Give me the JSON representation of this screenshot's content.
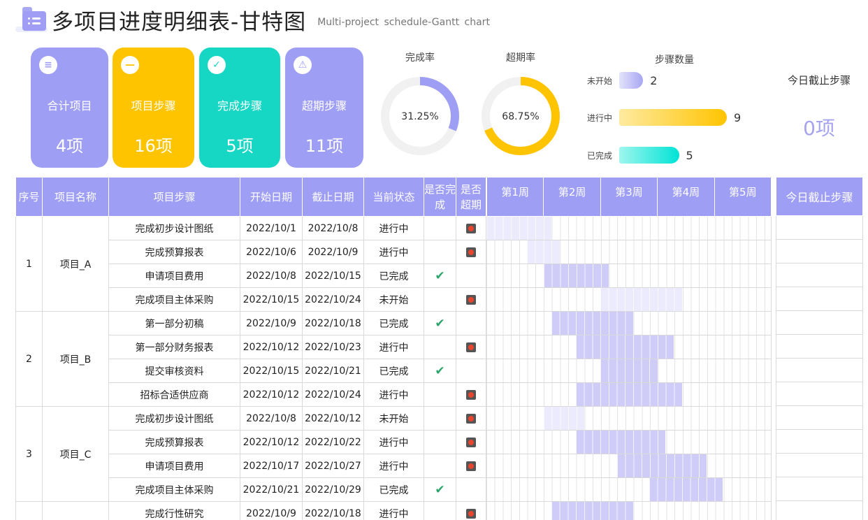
{
  "header": {
    "title": "多项目进度明细表-甘特图",
    "subtitle": "Multi-project  schedule-Gantt  chart"
  },
  "cards": [
    {
      "label": "合计项目",
      "value": "4项",
      "icon": "list-icon",
      "color": "#9f9ef5"
    },
    {
      "label": "项目步骤",
      "value": "16项",
      "icon": "minus-icon",
      "color": "#ffc400"
    },
    {
      "label": "完成步骤",
      "value": "5项",
      "icon": "check-icon",
      "color": "#16d6c4"
    },
    {
      "label": "超期步骤",
      "value": "11项",
      "icon": "warning-icon",
      "color": "#9f9ef5"
    }
  ],
  "donuts": [
    {
      "label": "完成率",
      "text": "31.25%",
      "value": 31.25,
      "color": "#9f9ef5"
    },
    {
      "label": "超期率",
      "text": "68.75%",
      "value": 68.75,
      "color": "#ffc400"
    }
  ],
  "steps": {
    "title": "步骤数量",
    "max": 9,
    "items": [
      {
        "label": "未开始",
        "value": 2
      },
      {
        "label": "进行中",
        "value": 9
      },
      {
        "label": "已完成",
        "value": 5
      }
    ]
  },
  "today": {
    "title": "今日截止步骤",
    "value": "0项"
  },
  "table": {
    "headers": {
      "no": "序号",
      "name": "项目名称",
      "step": "项目步骤",
      "start": "开始日期",
      "end": "截止日期",
      "status": "当前状态",
      "done": "是否完成",
      "overdue": "是否超期"
    },
    "weeks": [
      "第1周",
      "第2周",
      "第3周",
      "第4周",
      "第5周"
    ],
    "side_header": "今日截止步骤",
    "groups": [
      {
        "no": "1",
        "name": "项目_A",
        "rows": [
          {
            "step": "完成初步设计图纸",
            "start": "2022/10/1",
            "end": "2022/10/8",
            "status": "进行中",
            "done": false,
            "overdue": true,
            "d0": 1,
            "d1": 8
          },
          {
            "step": "完成预算报表",
            "start": "2022/10/6",
            "end": "2022/10/9",
            "status": "进行中",
            "done": false,
            "overdue": true,
            "d0": 6,
            "d1": 9
          },
          {
            "step": "申请项目费用",
            "start": "2022/10/8",
            "end": "2022/10/15",
            "status": "已完成",
            "done": true,
            "overdue": false,
            "d0": 8,
            "d1": 15
          },
          {
            "step": "完成项目主体采购",
            "start": "2022/10/15",
            "end": "2022/10/24",
            "status": "未开始",
            "done": false,
            "overdue": true,
            "d0": 15,
            "d1": 24
          }
        ]
      },
      {
        "no": "2",
        "name": "项目_B",
        "rows": [
          {
            "step": "第一部分初稿",
            "start": "2022/10/9",
            "end": "2022/10/18",
            "status": "已完成",
            "done": true,
            "overdue": false,
            "d0": 9,
            "d1": 18
          },
          {
            "step": "第一部分财务报表",
            "start": "2022/10/12",
            "end": "2022/10/23",
            "status": "进行中",
            "done": false,
            "overdue": true,
            "d0": 12,
            "d1": 23
          },
          {
            "step": "提交审核资料",
            "start": "2022/10/15",
            "end": "2022/10/21",
            "status": "已完成",
            "done": true,
            "overdue": false,
            "d0": 15,
            "d1": 21
          },
          {
            "step": "招标合适供应商",
            "start": "2022/10/12",
            "end": "2022/10/24",
            "status": "进行中",
            "done": false,
            "overdue": true,
            "d0": 12,
            "d1": 24
          }
        ]
      },
      {
        "no": "3",
        "name": "项目_C",
        "rows": [
          {
            "step": "完成初步设计图纸",
            "start": "2022/10/8",
            "end": "2022/10/12",
            "status": "未开始",
            "done": false,
            "overdue": true,
            "d0": 8,
            "d1": 12
          },
          {
            "step": "完成预算报表",
            "start": "2022/10/12",
            "end": "2022/10/22",
            "status": "进行中",
            "done": false,
            "overdue": true,
            "d0": 12,
            "d1": 22
          },
          {
            "step": "申请项目费用",
            "start": "2022/10/17",
            "end": "2022/10/27",
            "status": "进行中",
            "done": false,
            "overdue": true,
            "d0": 17,
            "d1": 27
          },
          {
            "step": "完成项目主体采购",
            "start": "2022/10/21",
            "end": "2022/10/29",
            "status": "已完成",
            "done": true,
            "overdue": false,
            "d0": 21,
            "d1": 29
          }
        ]
      },
      {
        "no": "",
        "name": "",
        "rows": [
          {
            "step": "完成行性研究",
            "start": "2022/10/9",
            "end": "2022/10/18",
            "status": "进行中",
            "done": false,
            "overdue": true,
            "d0": 9,
            "d1": 18
          }
        ]
      }
    ]
  }
}
